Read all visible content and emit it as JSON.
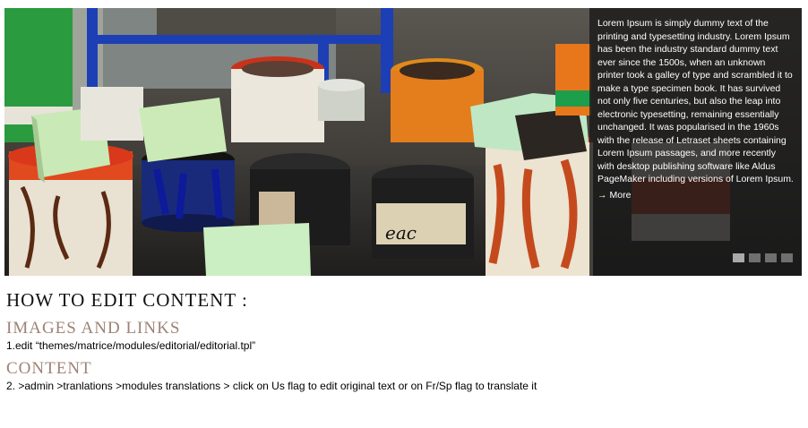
{
  "slider": {
    "caption": "Lorem Ipsum is simply dummy text of the printing and typesetting industry. Lorem Ipsum has been the industry standard dummy text ever since the 1500s, when an unknown printer took a galley of type and scrambled it to make a type specimen book. It has survived not only five centuries, but also the leap into electronic typesetting, remaining essentially unchanged. It was popularised in the 1960s with the release of Letraset sheets containing Lorem Ipsum passages, and more recently with desktop publishing software like Aldus PageMaker including versions of Lorem Ipsum.",
    "more_arrow": "→",
    "more_label": "More",
    "active_slide": 1,
    "slide_count": 4,
    "can_label": "eac"
  },
  "editorial": {
    "title": "HOW TO EDIT CONTENT :",
    "section1_heading": "IMAGES AND LINKS",
    "section1_text": "1.edit “themes/matrice/modules/editorial/editorial.tpl”",
    "section2_heading": "CONTENT",
    "section2_text": "2. >admin  >tranlations  >modules translations  > click on Us flag to edit original text or on Fr/Sp flag to translate it"
  },
  "colors": {
    "caption_bg": "#191919",
    "heading_sub": "#9e8276",
    "pager_active": "#a9a9a9",
    "pager_inactive": "#6f6f6f"
  }
}
